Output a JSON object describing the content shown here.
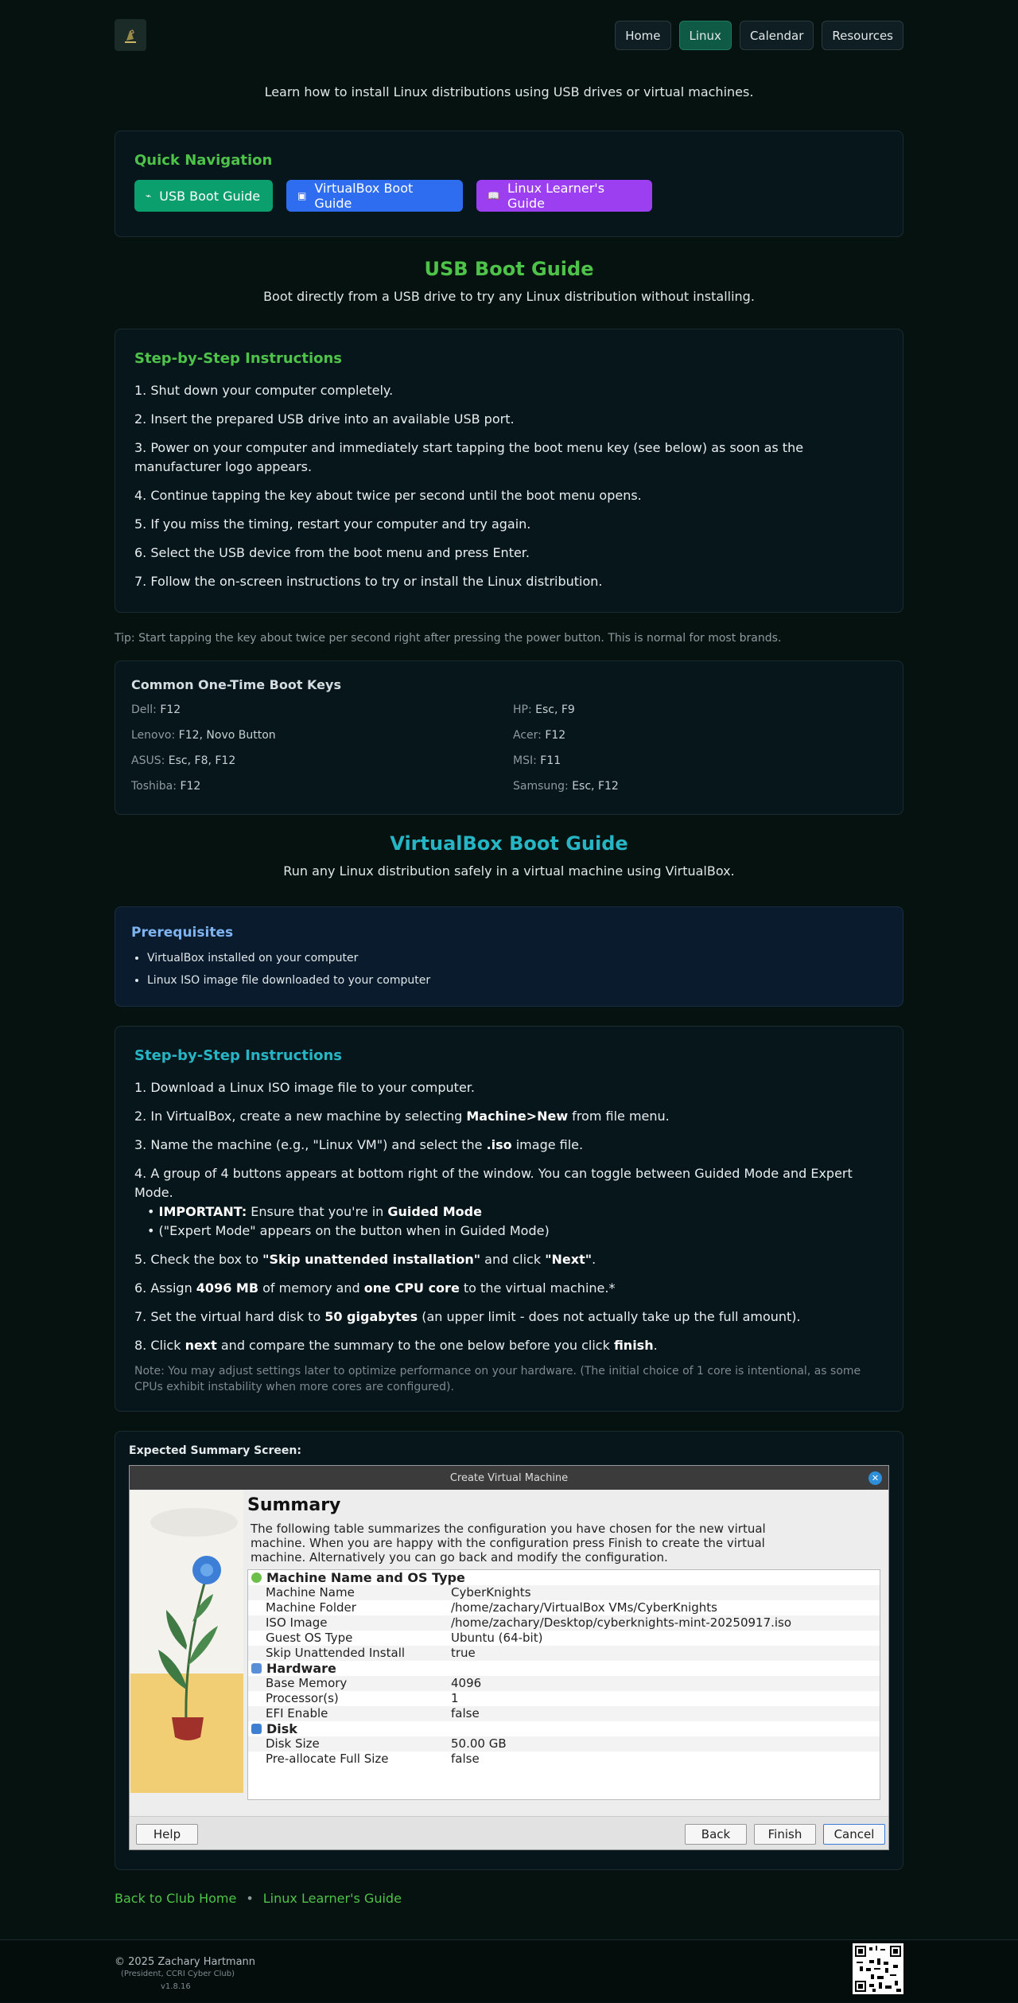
{
  "nav": {
    "logo_alt": "club logo",
    "items": [
      {
        "label": "Home",
        "active": false
      },
      {
        "label": "Linux",
        "active": true
      },
      {
        "label": "Calendar",
        "active": false
      },
      {
        "label": "Resources",
        "active": false
      }
    ]
  },
  "intro": "Learn how to install Linux distributions using USB drives or virtual machines.",
  "quick_nav": {
    "title": "Quick Navigation",
    "buttons": [
      {
        "label": "USB Boot Guide",
        "icon": "usb-icon"
      },
      {
        "label": "VirtualBox Boot Guide",
        "icon": "cube-icon"
      },
      {
        "label": "Linux Learner's Guide",
        "icon": "book-icon"
      }
    ]
  },
  "usb": {
    "title": "USB Boot Guide",
    "subtitle": "Boot directly from a USB drive to try any Linux distribution without installing.",
    "steps_title": "Step-by-Step Instructions",
    "steps": [
      "1. Shut down your computer completely.",
      "2. Insert the prepared USB drive into an available USB port.",
      "3. Power on your computer and immediately start tapping the boot menu key (see below) as soon as the manufacturer logo appears.",
      "4. Continue tapping the key about twice per second until the boot menu opens.",
      "5. If you miss the timing, restart your computer and try again.",
      "6. Select the USB device from the boot menu and press Enter.",
      "7. Follow the on-screen instructions to try or install the Linux distribution."
    ],
    "tip": "Tip: Start tapping the key about twice per second right after pressing the power button. This is normal for most brands.",
    "boot_keys_title": "Common One-Time Boot Keys",
    "boot_keys": [
      {
        "brand": "Dell:",
        "keys": "F12"
      },
      {
        "brand": "HP:",
        "keys": "Esc, F9"
      },
      {
        "brand": "Lenovo:",
        "keys": "F12, Novo Button"
      },
      {
        "brand": "Acer:",
        "keys": "F12"
      },
      {
        "brand": "ASUS:",
        "keys": "Esc, F8, F12"
      },
      {
        "brand": "MSI:",
        "keys": "F11"
      },
      {
        "brand": "Toshiba:",
        "keys": "F12"
      },
      {
        "brand": "Samsung:",
        "keys": "Esc, F12"
      }
    ]
  },
  "vbox": {
    "title": "VirtualBox Boot Guide",
    "subtitle": "Run any Linux distribution safely in a virtual machine using VirtualBox.",
    "prereq_title": "Prerequisites",
    "prereqs": [
      "VirtualBox installed on your computer",
      "Linux ISO image file downloaded to your computer"
    ],
    "steps_title": "Step-by-Step Instructions",
    "steps": {
      "s1": "1. Download a Linux ISO image file to your computer.",
      "s2a": "2. In VirtualBox, create a new machine by selecting ",
      "s2b": "Machine>New",
      "s2c": " from file menu.",
      "s3a": "3. Name the machine (e.g., \"Linux VM\") and select the ",
      "s3b": ".iso",
      "s3c": " image file.",
      "s4": "4. A group of 4 buttons appears at bottom right of the window. You can toggle between Guided Mode and Expert Mode.",
      "s4_b1a": "• ",
      "s4_b1b": "IMPORTANT:",
      "s4_b1c": " Ensure that you're in ",
      "s4_b1d": "Guided Mode",
      "s4_b2": "• (\"Expert Mode\" appears on the button when in Guided Mode)",
      "s5a": "5. Check the box to ",
      "s5b": "\"Skip unattended installation\"",
      "s5c": " and click ",
      "s5d": "\"Next\"",
      "s5e": ".",
      "s6a": "6. Assign ",
      "s6b": "4096 MB",
      "s6c": " of memory and ",
      "s6d": "one CPU core",
      "s6e": " to the virtual machine.*",
      "s7a": "7. Set the virtual hard disk to ",
      "s7b": "50 gigabytes",
      "s7c": " (an upper limit - does not actually take up the full amount).",
      "s8a": "8. Click ",
      "s8b": "next",
      "s8c": " and compare the summary to the one below before you click ",
      "s8d": "finish",
      "s8e": "."
    },
    "note": "Note: You may adjust settings later to optimize performance on your hardware. (The initial choice of 1 core is intentional, as some CPUs exhibit instability when more cores are configured)."
  },
  "summary": {
    "label": "Expected Summary Screen:",
    "dialog_title": "Create Virtual Machine",
    "heading": "Summary",
    "description": "The following table summarizes the configuration you have chosen for the new virtual machine. When you are happy with the configuration press Finish to create the virtual machine. Alternatively you can go back and modify the configuration.",
    "groups": [
      {
        "name": "Machine Name and OS Type",
        "rows": [
          [
            "Machine Name",
            "CyberKnights"
          ],
          [
            "Machine Folder",
            "/home/zachary/VirtualBox VMs/CyberKnights"
          ],
          [
            "ISO Image",
            "/home/zachary/Desktop/cyberknights-mint-20250917.iso"
          ],
          [
            "Guest OS Type",
            "Ubuntu (64-bit)"
          ],
          [
            "Skip Unattended Install",
            "true"
          ]
        ]
      },
      {
        "name": "Hardware",
        "rows": [
          [
            "Base Memory",
            "4096"
          ],
          [
            "Processor(s)",
            "1"
          ],
          [
            "EFI Enable",
            "false"
          ]
        ]
      },
      {
        "name": "Disk",
        "rows": [
          [
            "Disk Size",
            "50.00 GB"
          ],
          [
            "Pre-allocate Full Size",
            "false"
          ]
        ]
      }
    ],
    "buttons": {
      "help": "Help",
      "back": "Back",
      "finish": "Finish",
      "cancel": "Cancel"
    }
  },
  "links": {
    "home": "Back to Club Home",
    "sep": "•",
    "guide": "Linux Learner's Guide"
  },
  "footer": {
    "copyright": "© 2025 Zachary Hartmann",
    "role": "(President, CCRI Cyber Club)",
    "version": "v1.8.16"
  }
}
